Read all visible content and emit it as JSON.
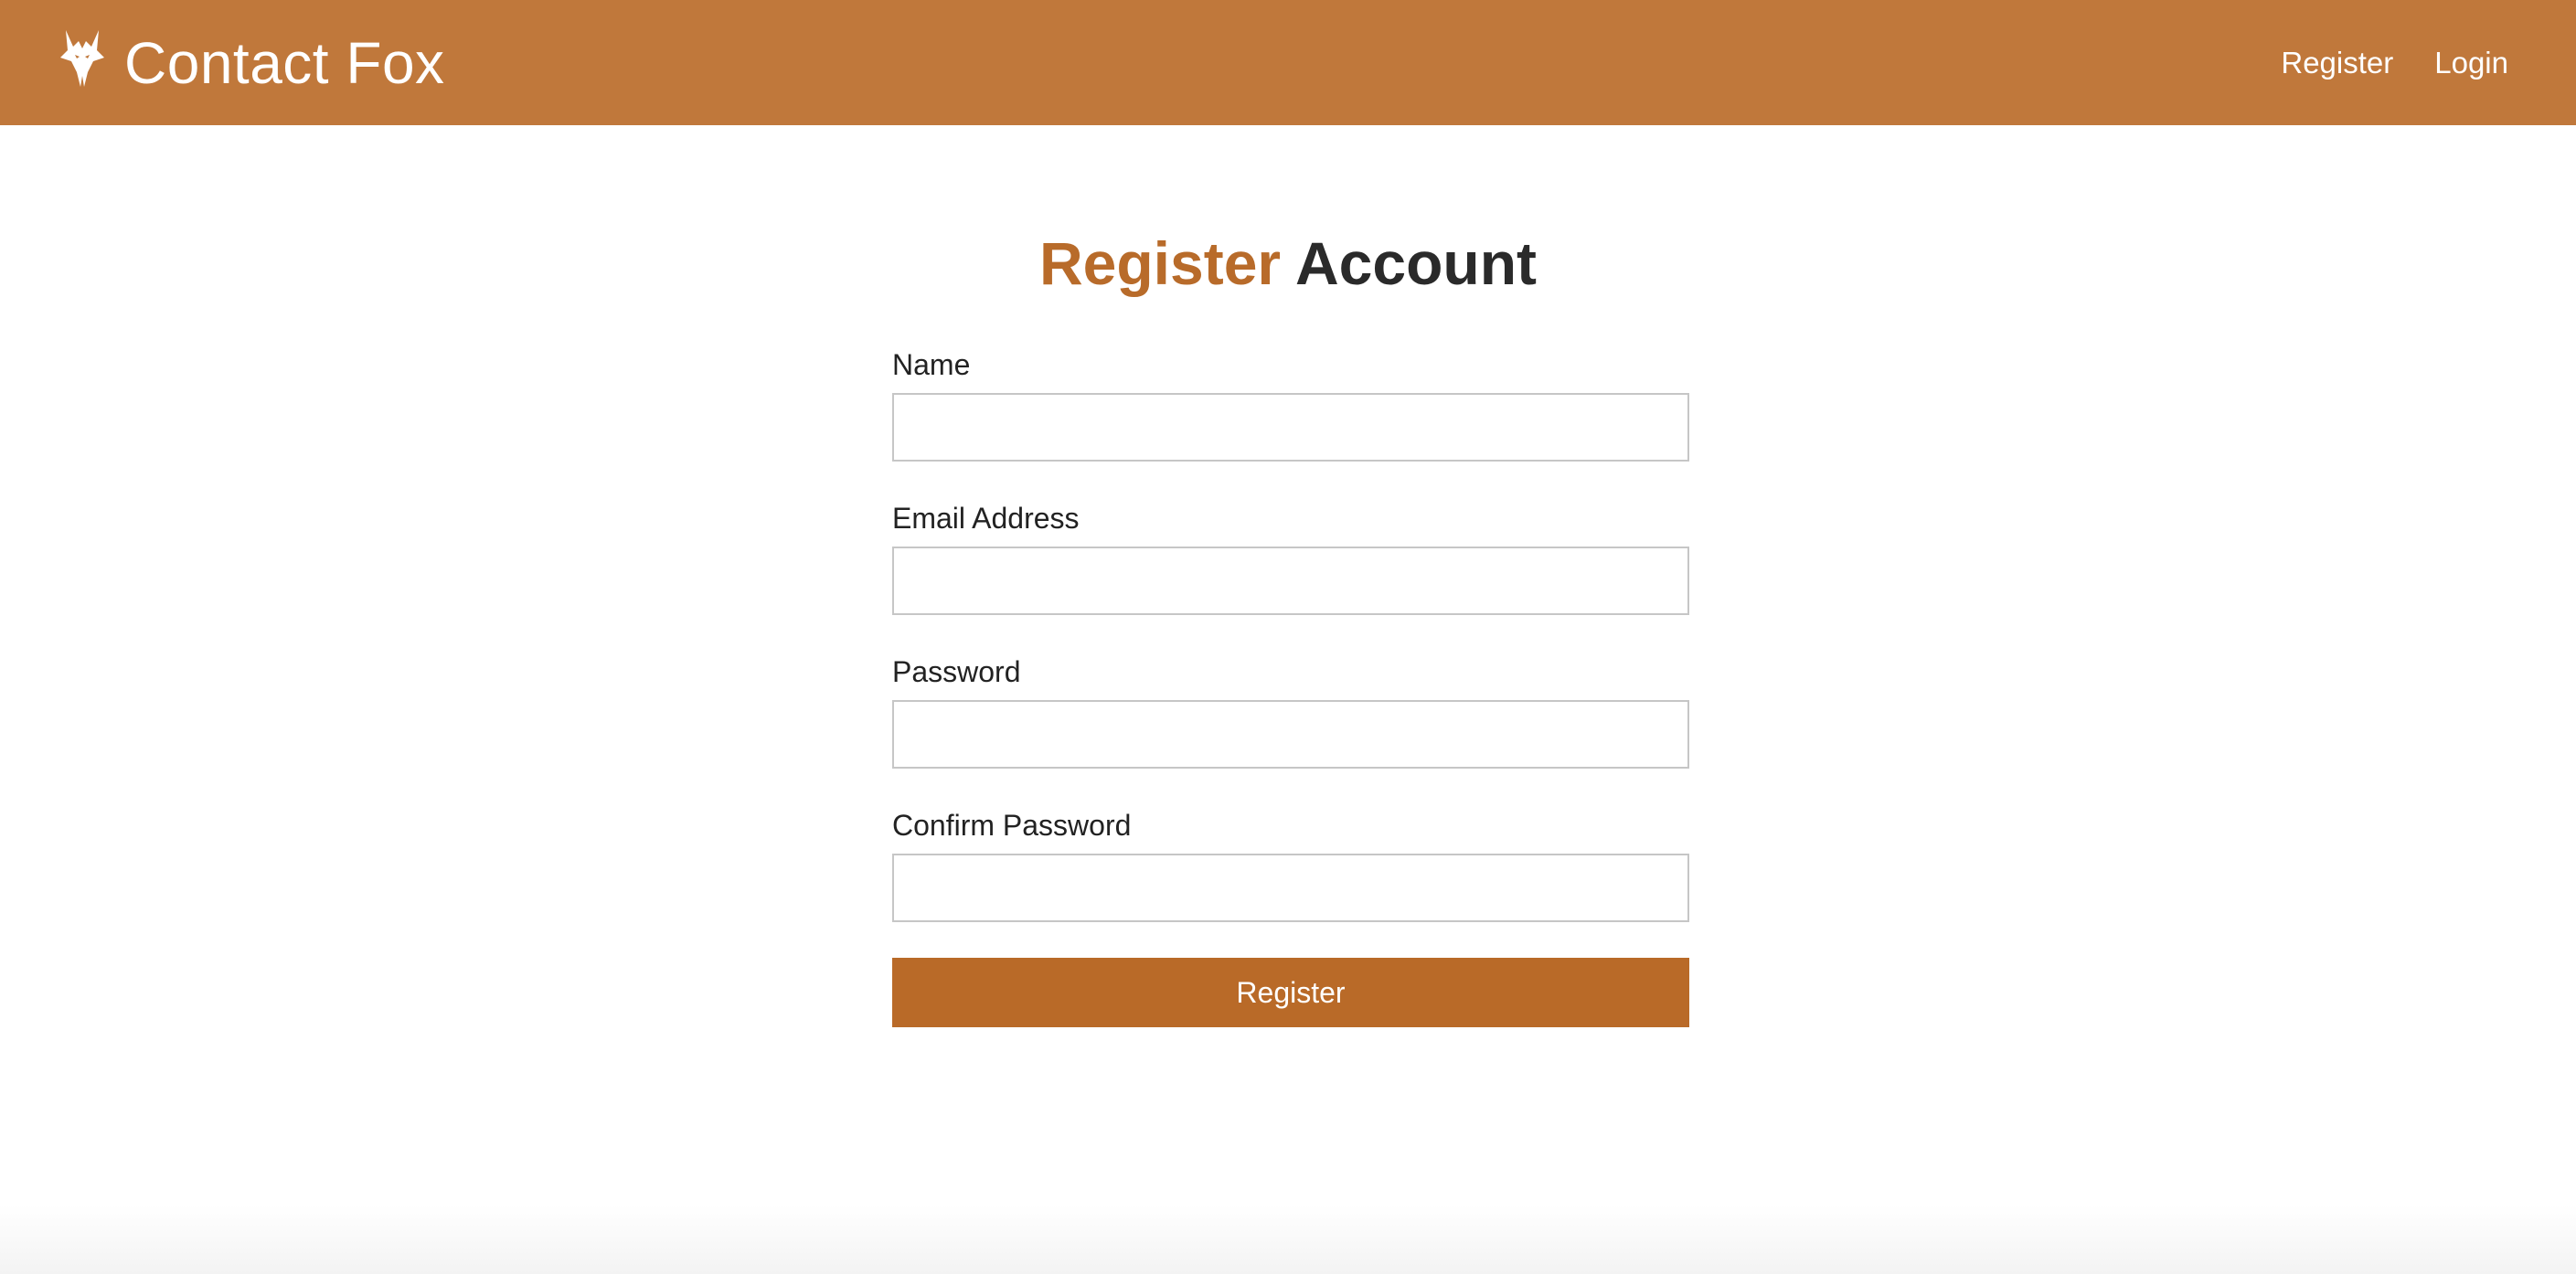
{
  "app": {
    "title": "Contact Fox",
    "brand_color": "#c0783b",
    "accent_color": "#b96a28"
  },
  "navbar": {
    "brand_icon": "fox-icon",
    "links": [
      {
        "label": "Register"
      },
      {
        "label": "Login"
      }
    ]
  },
  "page": {
    "heading_accent": "Register",
    "heading_rest": "Account"
  },
  "form": {
    "fields": [
      {
        "label": "Name",
        "value": "",
        "type": "text"
      },
      {
        "label": "Email Address",
        "value": "",
        "type": "email"
      },
      {
        "label": "Password",
        "value": "",
        "type": "password"
      },
      {
        "label": "Confirm Password",
        "value": "",
        "type": "password"
      }
    ],
    "submit_label": "Register"
  }
}
